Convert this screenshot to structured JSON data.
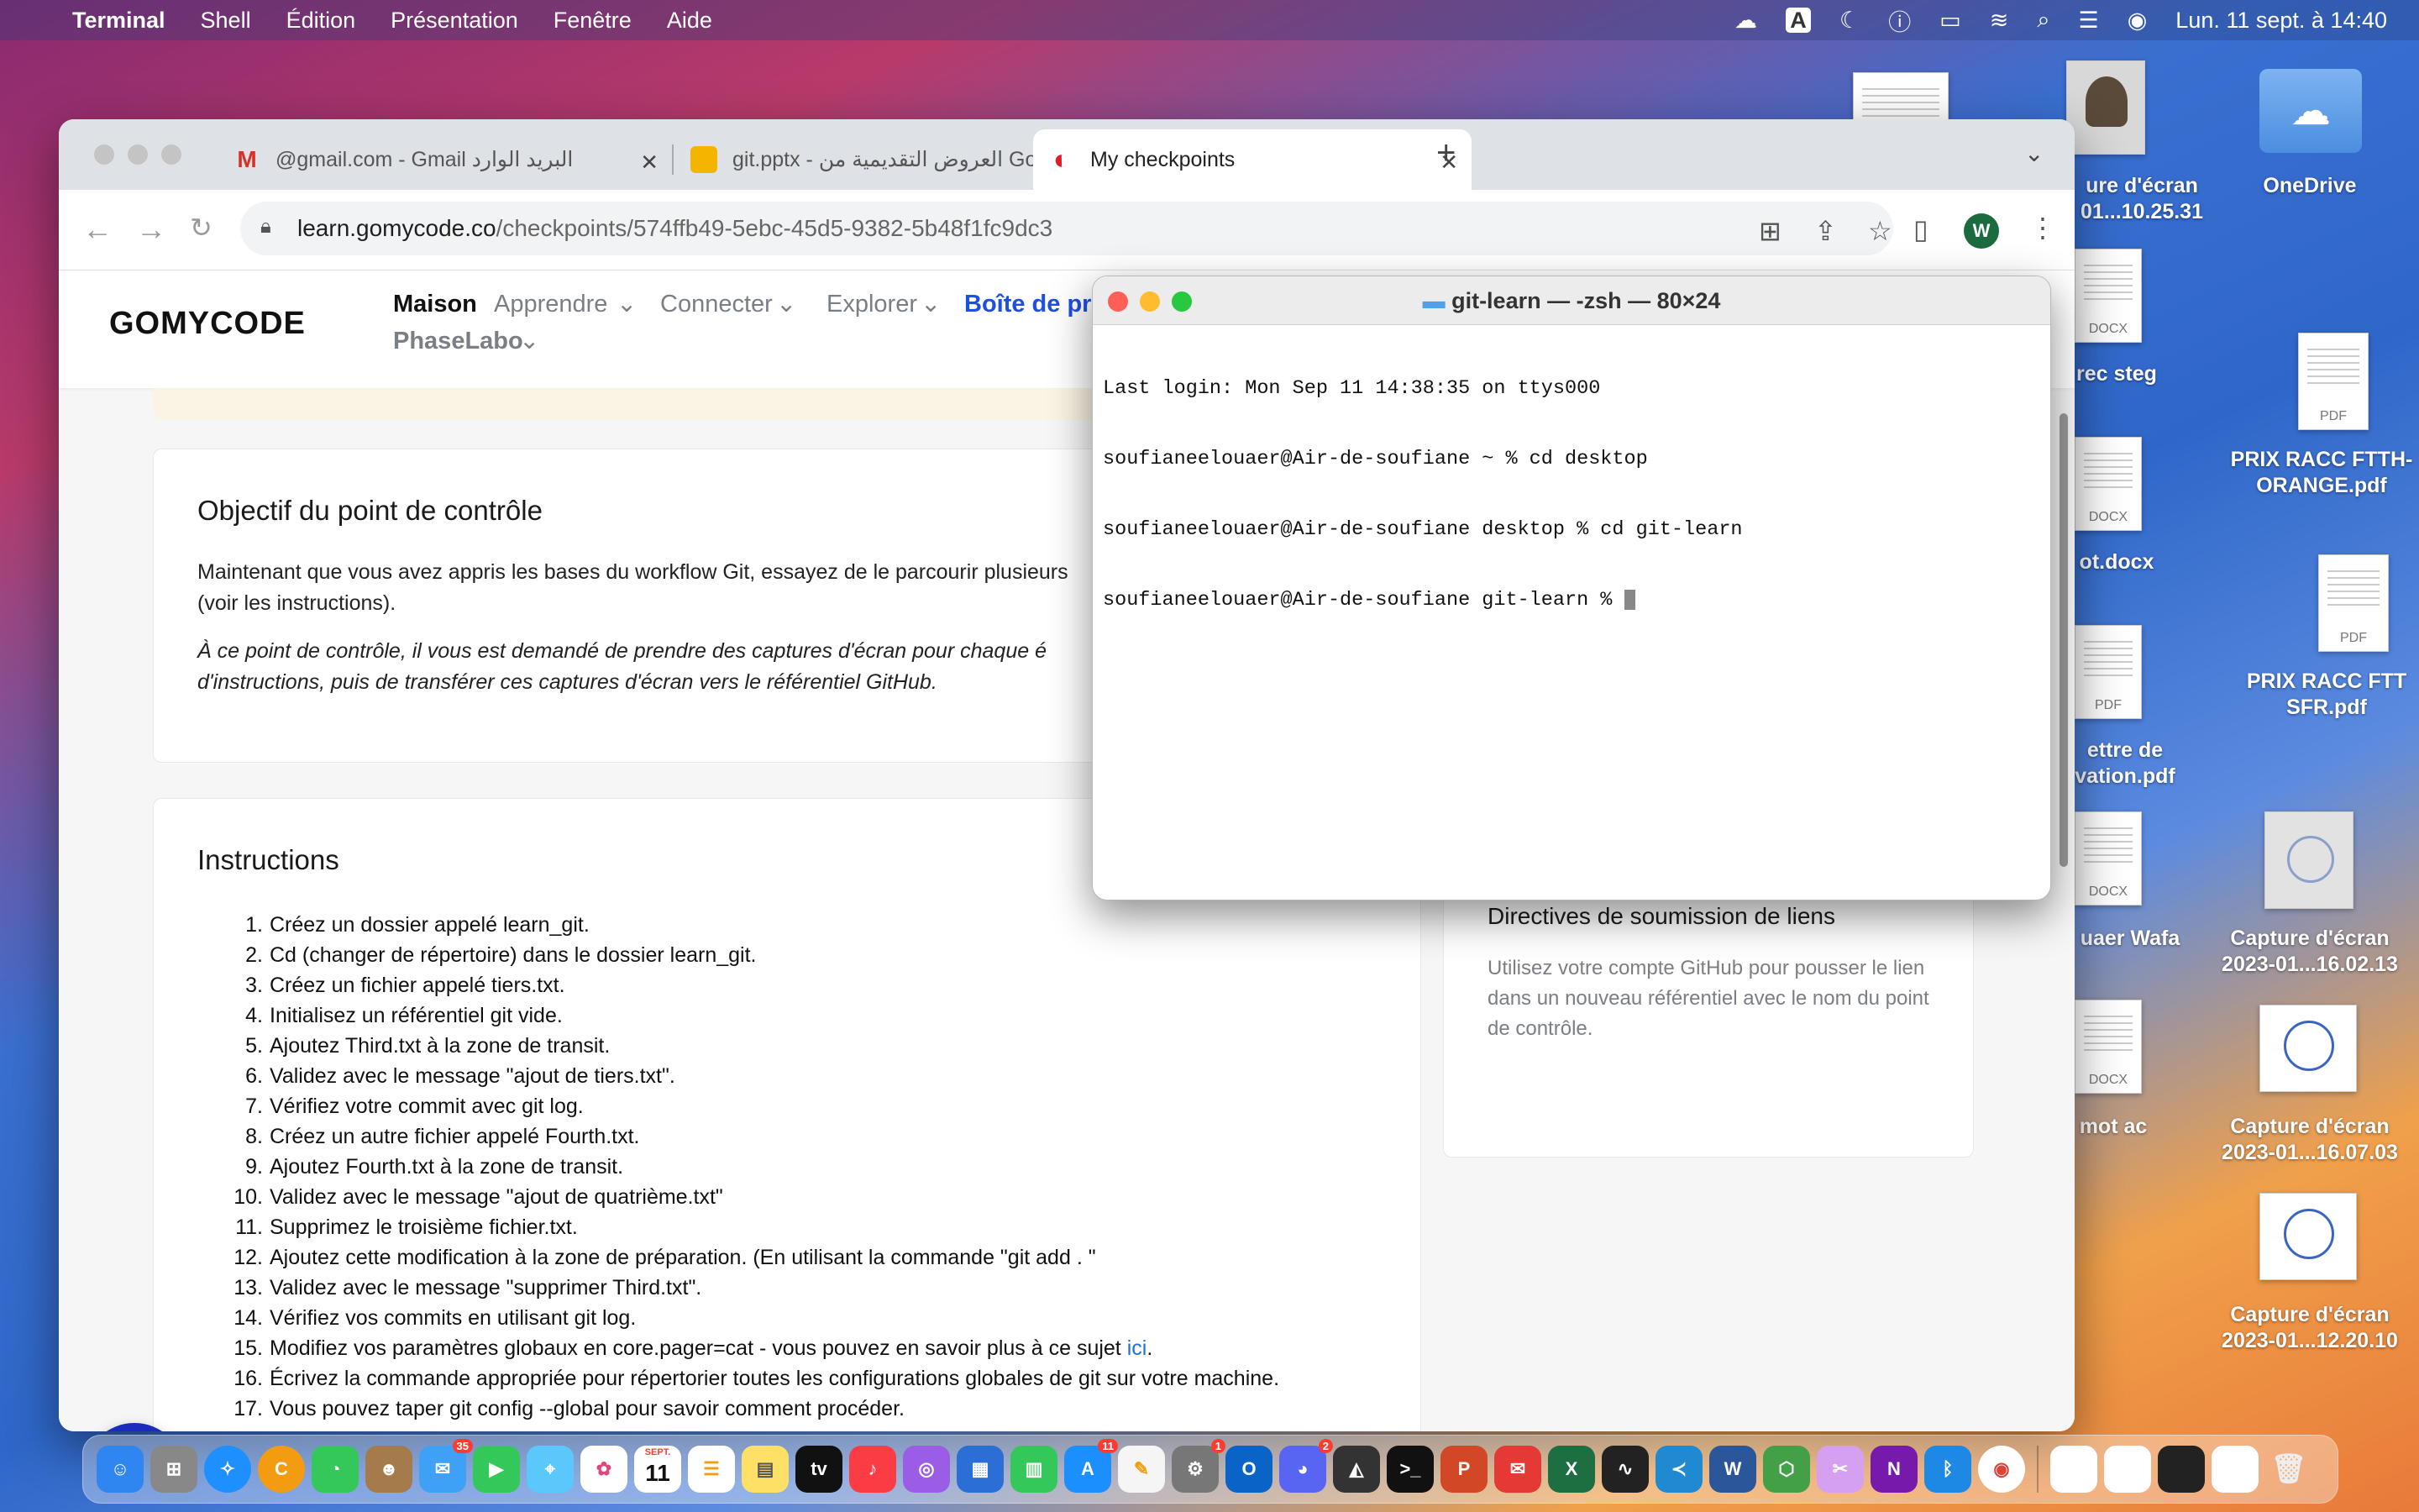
{
  "menubar": {
    "app": "Terminal",
    "items": [
      "Shell",
      "Édition",
      "Présentation",
      "Fenêtre",
      "Aide"
    ],
    "clock": "Lun. 11 sept. à  14:40",
    "input_indicator": "A"
  },
  "browser": {
    "tabs": [
      {
        "title": "@gmail.com - Gmail البريد الوارد"
      },
      {
        "title": "git.pptx - العروض التقديمية من Go"
      },
      {
        "title": "My checkpoints"
      }
    ],
    "url_domain": "learn.gomycode.co",
    "url_path": "/checkpoints/574ffb49-5ebc-45d5-9382-5b48f1fc9dc3",
    "profile_initial": "W"
  },
  "site": {
    "logo": "GOMYCODE",
    "nav": {
      "home": "Maison",
      "learn": "Apprendre",
      "connect": "Connecter",
      "explore": "Explorer",
      "toolbox": "Boîte de prat",
      "phaselabo": "PhaseLabo"
    },
    "objective": {
      "title": "Objectif du point de contrôle",
      "p1a": "Maintenant que vous avez appris les bases du workflow Git, essayez de le parcourir plusieurs",
      "p1b": "(voir les instructions).",
      "p2a": "À  ce point de contrôle, il vous est  demandé  de prendre des captures d'écran pour chaque é",
      "p2b": "d'instructions, puis de transférer ces captures d'écran vers le référentiel GitHub."
    },
    "instructions": {
      "title": "Instructions",
      "steps": [
        "Créez un dossier appelé learn_git.",
        "Cd (changer de répertoire) dans le dossier learn_git.",
        "Créez un fichier appelé tiers.txt.",
        "Initialisez un référentiel git vide.",
        "Ajoutez Third.txt à la zone de transit.",
        "Validez avec le message \"ajout de tiers.txt\".",
        "Vérifiez votre commit avec git log.",
        "Créez un autre fichier appelé Fourth.txt.",
        "Ajoutez Fourth.txt à la zone de transit.",
        "Validez avec le message \"ajout de quatrième.txt\"",
        "Supprimez le troisième fichier.txt.",
        "Ajoutez cette modification à la zone de préparation. (En utilisant la commande \"git add . \"",
        "Validez avec le message \"supprimer Third.txt\".",
        "Vérifiez vos commits en utilisant git log.",
        "Modifiez vos paramètres globaux en core.pager=cat - vous pouvez en savoir plus à ce sujet",
        "Écrivez la commande appropriée pour répertorier toutes les configurations globales de git sur votre machine.",
        "Vous pouvez taper git config --global pour savoir comment procéder."
      ],
      "step15_link": "ici",
      "step15_tail": " ."
    },
    "links_card": {
      "title": "Directives de soumission de liens",
      "body": "Utilisez votre compte GitHub pour pousser le lien dans un nouveau référentiel avec le nom du point de contrôle."
    }
  },
  "terminal": {
    "title": "git-learn — -zsh — 80×24",
    "lines": [
      "Last login: Mon Sep 11 14:38:35 on ttys000",
      "soufianeelouaer@Air-de-soufiane ~ % cd desktop",
      "soufianeelouaer@Air-de-soufiane desktop % cd git-learn",
      "soufianeelouaer@Air-de-soufiane git-learn % "
    ]
  },
  "desktop": {
    "icons": [
      {
        "label": "ure d'écran\n01...10.25.31"
      },
      {
        "label": "OneDrive"
      },
      {
        "label": "rec steg",
        "tag": "DOCX"
      },
      {
        "label": "PRIX RACC FTTH-\nORANGE.pdf",
        "tag": "PDF"
      },
      {
        "label": "ot.docx",
        "tag": "DOCX"
      },
      {
        "label": "PRIX RACC FTT\nSFR.pdf",
        "tag": "PDF"
      },
      {
        "label": "ettre de\nvation.pdf",
        "tag": "PDF"
      },
      {
        "label": "uaer Wafa",
        "tag": "DOCX"
      },
      {
        "label": "Capture d'écran\n2023-01...16.02.13"
      },
      {
        "label": "mot ac",
        "tag": "DOCX"
      },
      {
        "label": "Capture d'écran\n2023-01...16.07.03"
      },
      {
        "label": "Capture d'écran\n2023-01...12.20.10"
      }
    ]
  },
  "dock": {
    "badges": {
      "mail": "35",
      "calendar_day": "11",
      "calendar_month": "SEPT.",
      "appstore": "11",
      "settings": "1",
      "discord": "2"
    }
  }
}
